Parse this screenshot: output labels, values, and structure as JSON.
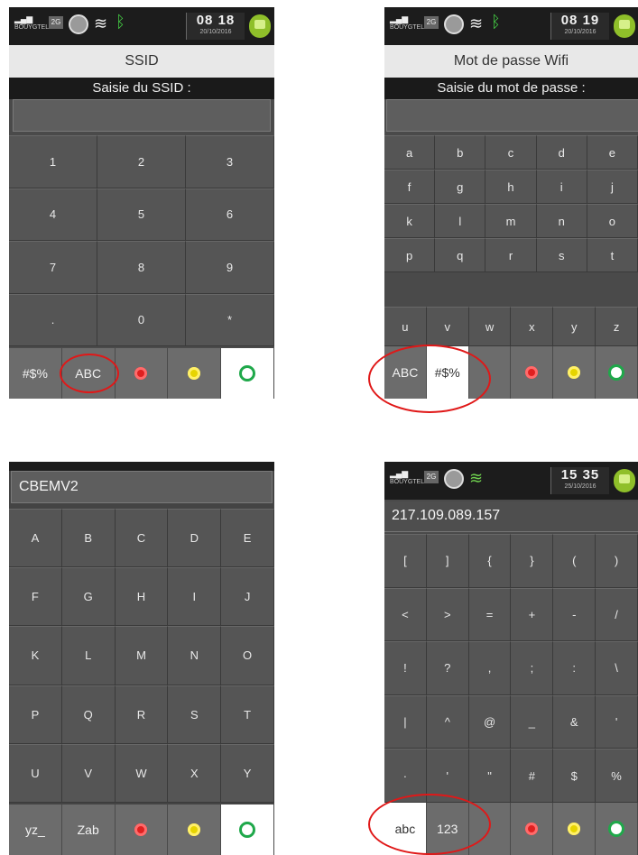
{
  "screens": [
    {
      "status": {
        "operator": "BOUYGTEL",
        "net": "2G",
        "time": "08 18",
        "date": "20/10/2016"
      },
      "title": "SSID",
      "prompt": "Saisie du SSID :",
      "field": "",
      "keys": [
        "1",
        "2",
        "3",
        "4",
        "5",
        "6",
        "7",
        "8",
        "9",
        ".",
        "0",
        "*"
      ],
      "bottom": [
        {
          "label": "#$%"
        },
        {
          "label": "ABC"
        },
        {
          "icon": "cancel-icon"
        },
        {
          "icon": "correct-icon"
        },
        {
          "icon": "validate-icon",
          "white": true
        }
      ]
    },
    {
      "status": {
        "operator": "BOUYGTEL",
        "net": "2G",
        "time": "08 19",
        "date": "20/10/2016"
      },
      "title": "Mot de passe Wifi",
      "prompt": "Saisie du mot de passe :",
      "field": "",
      "keys": [
        "a",
        "b",
        "c",
        "d",
        "e",
        "f",
        "g",
        "h",
        "i",
        "j",
        "k",
        "l",
        "m",
        "n",
        "o",
        "p",
        "q",
        "r",
        "s",
        "t",
        "u",
        "v",
        "w",
        "x",
        "y",
        "z"
      ],
      "bottom": [
        {
          "label": "ABC"
        },
        {
          "label": "#$%",
          "white": true
        },
        {
          "label": ""
        },
        {
          "icon": "cancel-icon"
        },
        {
          "icon": "correct-icon"
        },
        {
          "icon": "validate-icon"
        }
      ]
    },
    {
      "field": "CBEMV2",
      "keys": [
        "A",
        "B",
        "C",
        "D",
        "E",
        "F",
        "G",
        "H",
        "I",
        "J",
        "K",
        "L",
        "M",
        "N",
        "O",
        "P",
        "Q",
        "R",
        "S",
        "T",
        "U",
        "V",
        "W",
        "X",
        "Y"
      ],
      "bottom": [
        {
          "label": "yz_"
        },
        {
          "label": "Zab"
        },
        {
          "icon": "cancel-icon"
        },
        {
          "icon": "correct-icon"
        },
        {
          "icon": "validate-icon",
          "white": true
        }
      ]
    },
    {
      "status": {
        "operator": "BOUYGTEL",
        "net": "2G",
        "time": "15 35",
        "date": "25/10/2016"
      },
      "field": "217.109.089.157",
      "keys": [
        "[",
        "]",
        "{",
        "}",
        "(",
        ")",
        "<",
        ">",
        "=",
        "+",
        "-",
        "/",
        "!",
        "?",
        ",",
        ";",
        ":",
        "\\",
        "|",
        "^",
        "@",
        "_",
        "&",
        "'",
        "·",
        "'",
        "\"",
        "#",
        "$",
        "%"
      ],
      "bottom": [
        {
          "label": "abc",
          "white": true
        },
        {
          "label": "123"
        },
        {
          "label": ""
        },
        {
          "icon": "cancel-icon"
        },
        {
          "icon": "correct-icon"
        },
        {
          "icon": "validate-icon"
        }
      ]
    }
  ],
  "colors": {
    "cancel": "#e02020",
    "correct": "#e6d400",
    "validate": "#1fa84a",
    "highlight": "#e01818"
  }
}
